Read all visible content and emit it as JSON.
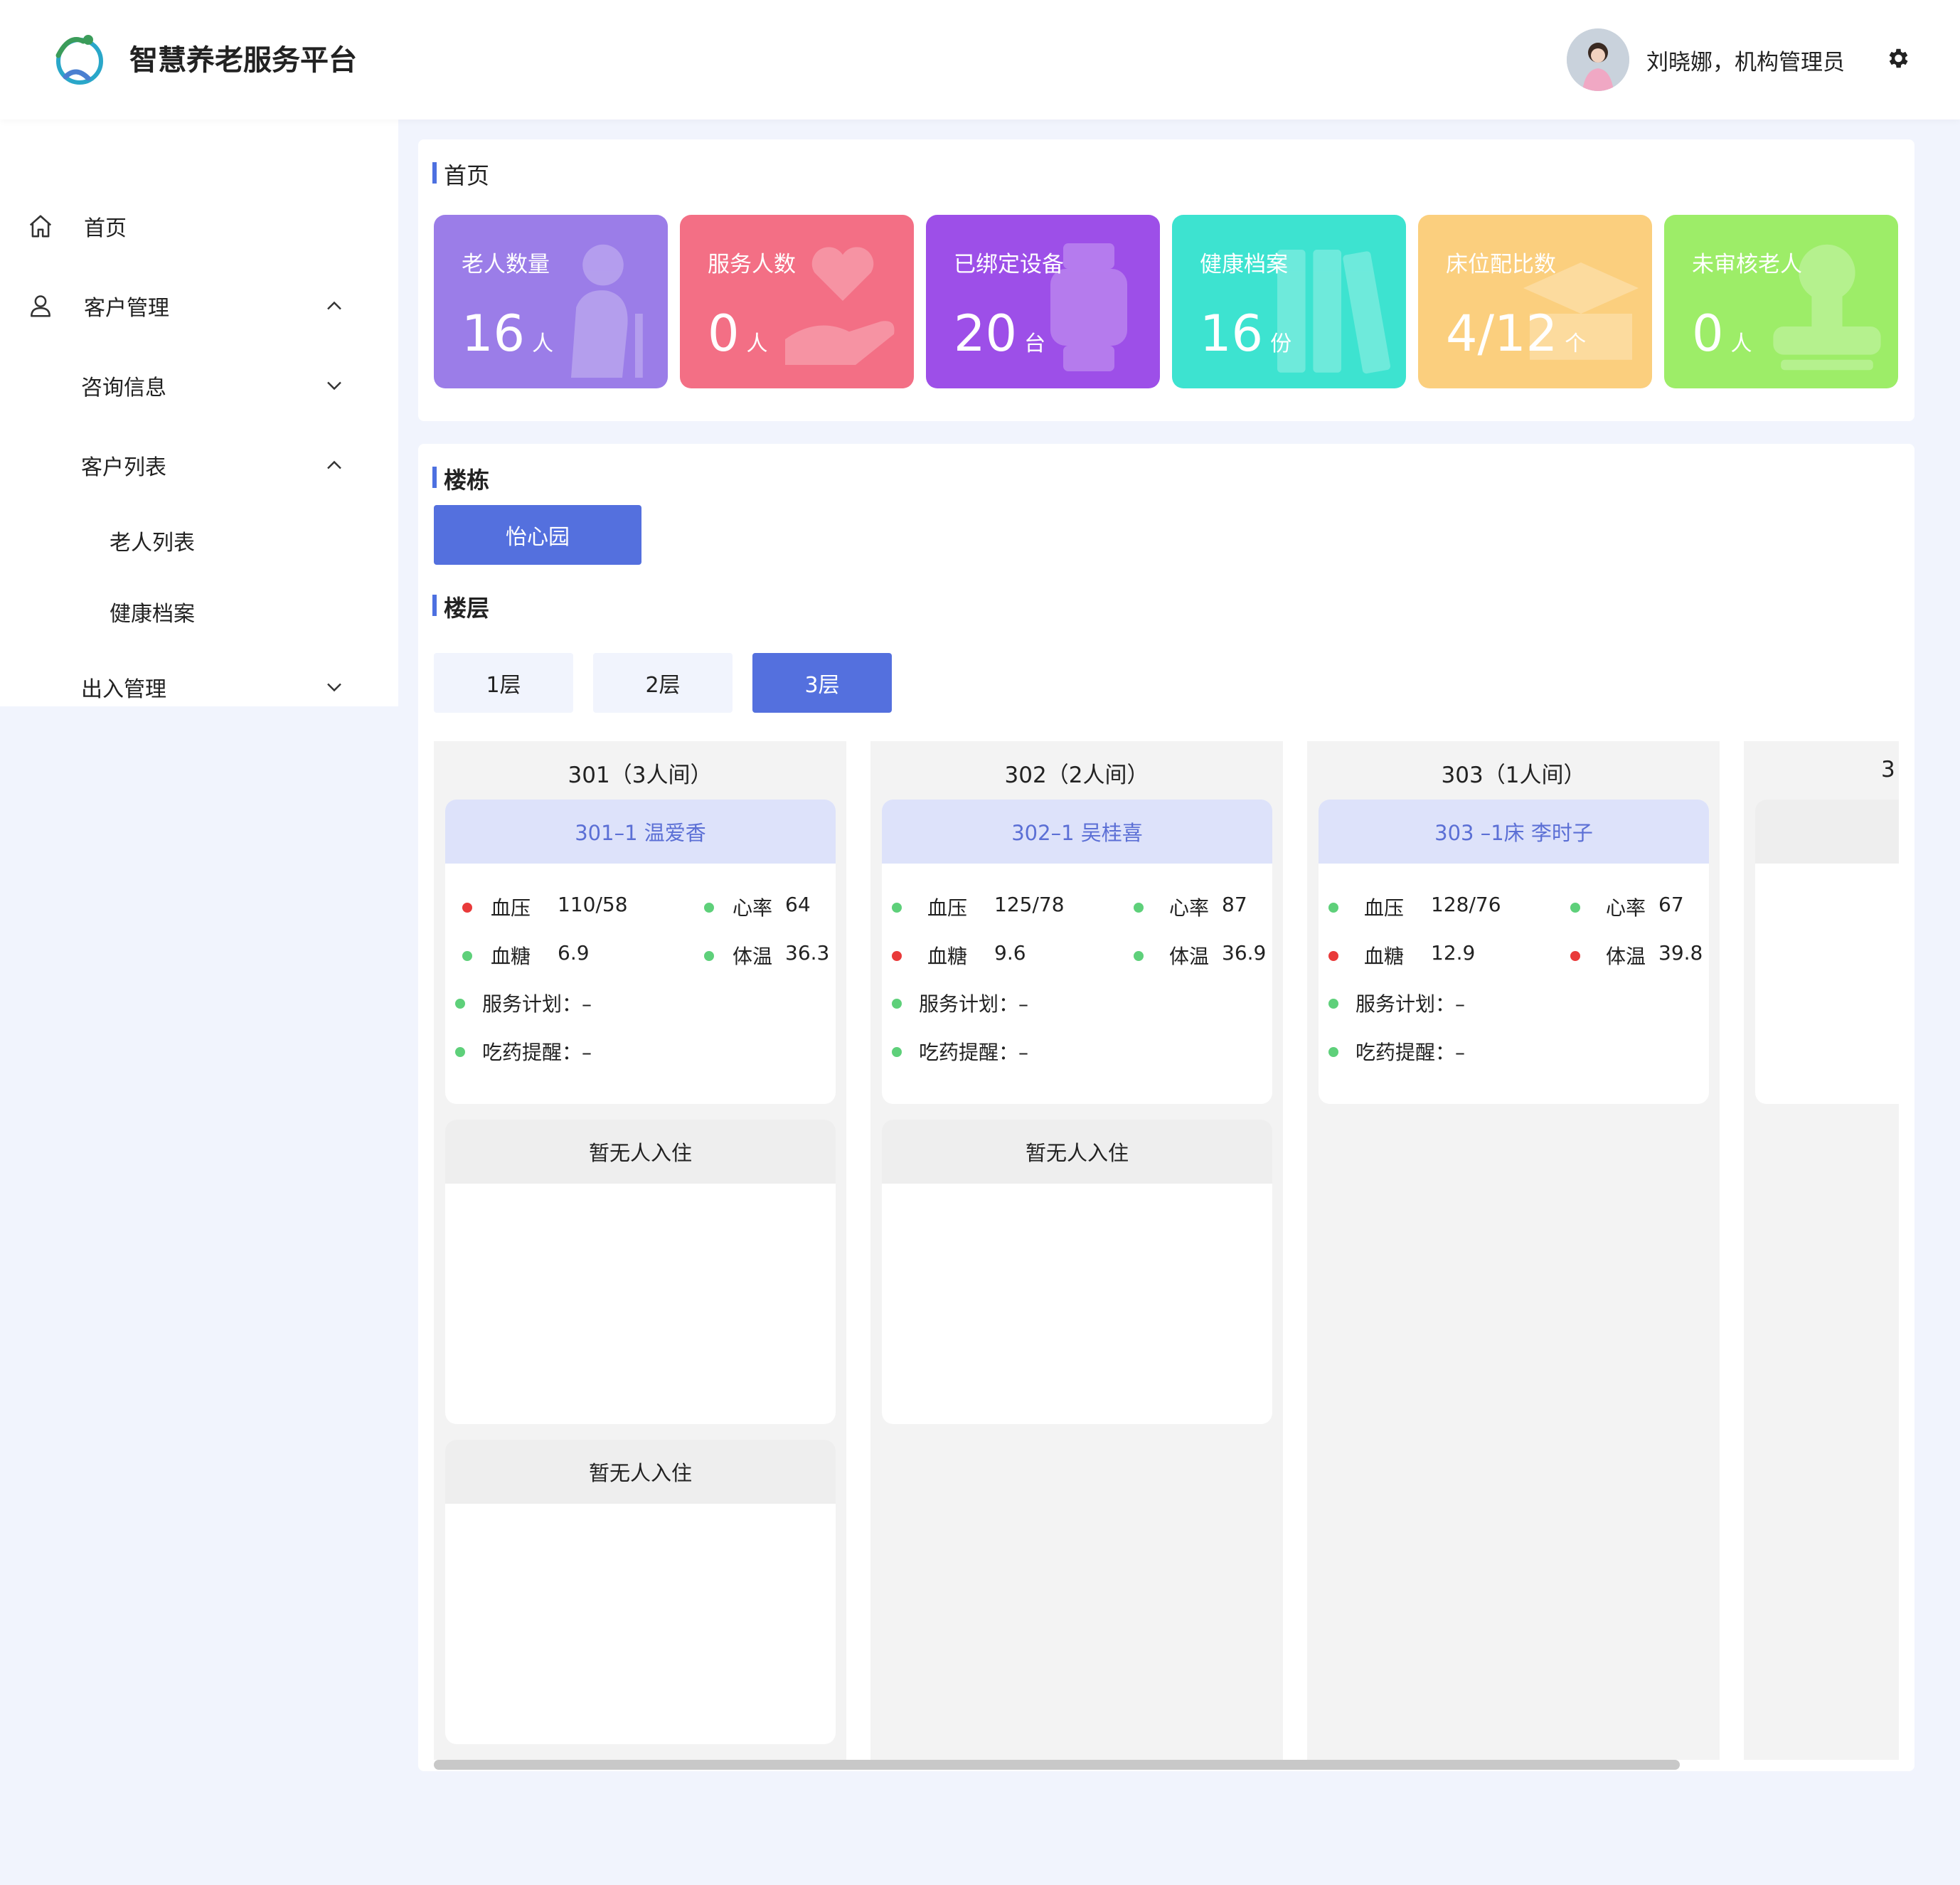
{
  "header": {
    "app_title": "智慧养老服务平台",
    "user_text": "刘晓娜，机构管理员"
  },
  "sidebar": {
    "items": [
      {
        "label": "首页",
        "icon": "home-icon"
      },
      {
        "label": "客户管理",
        "icon": "user-icon",
        "expanded": true
      },
      {
        "label": "咨询信息",
        "expanded": false
      },
      {
        "label": "客户列表",
        "expanded": true
      },
      {
        "label": "老人列表"
      },
      {
        "label": "健康档案"
      },
      {
        "label": "出入管理",
        "expanded": false
      }
    ]
  },
  "home": {
    "title": "首页",
    "stats": [
      {
        "label": "老人数量",
        "value": "16",
        "unit": "人",
        "color": "#9b7de8",
        "icon": "elderly-icon"
      },
      {
        "label": "服务人数",
        "value": "0",
        "unit": "人",
        "color": "#f36f85",
        "icon": "heart-hand-icon"
      },
      {
        "label": "已绑定设备",
        "value": "20",
        "unit": "台",
        "color": "#9d4fe8",
        "icon": "watch-icon"
      },
      {
        "label": "健康档案",
        "value": "16",
        "unit": "份",
        "color": "#3de3d0",
        "icon": "binder-icon"
      },
      {
        "label": "床位配比数",
        "value": "4/12",
        "unit": "个",
        "color": "#fbcf7e",
        "icon": "bed-icon"
      },
      {
        "label": "未审核老人",
        "value": "0",
        "unit": "人",
        "color": "#9ded68",
        "icon": "stamp-icon"
      }
    ]
  },
  "building": {
    "title": "楼栋",
    "selected": "怡心园"
  },
  "floor": {
    "title": "楼层",
    "options": [
      "1层",
      "2层",
      "3层"
    ],
    "selected": "3层"
  },
  "rooms": [
    {
      "title": "301（3人间）",
      "beds": [
        {
          "header": "301–1 温爱香",
          "occupied": true,
          "bp_label": "血压",
          "bp": "110/58",
          "bp_status": "red",
          "hr_label": "心率",
          "hr": "64",
          "hr_status": "green",
          "bs_label": "血糖",
          "bs": "6.9",
          "bs_status": "green",
          "temp_label": "体温",
          "temp": "36.3",
          "temp_status": "green",
          "plan": "服务计划：–",
          "reminder": "吃药提醒：–"
        },
        {
          "header": "暂无人入住",
          "occupied": false
        },
        {
          "header": "暂无人入住",
          "occupied": false
        }
      ]
    },
    {
      "title": "302（2人间）",
      "beds": [
        {
          "header": "302–1 吴桂喜",
          "occupied": true,
          "bp_label": "血压",
          "bp": "125/78",
          "bp_status": "green",
          "hr_label": "心率",
          "hr": "87",
          "hr_status": "green",
          "bs_label": "血糖",
          "bs": "9.6",
          "bs_status": "red",
          "temp_label": "体温",
          "temp": "36.9",
          "temp_status": "green",
          "plan": "服务计划：–",
          "reminder": "吃药提醒：–"
        },
        {
          "header": "暂无人入住",
          "occupied": false
        }
      ]
    },
    {
      "title": "303（1人间）",
      "beds": [
        {
          "header": "303 –1床 李时子",
          "occupied": true,
          "bp_label": "血压",
          "bp": "128/76",
          "bp_status": "green",
          "hr_label": "心率",
          "hr": "67",
          "hr_status": "green",
          "bs_label": "血糖",
          "bs": "12.9",
          "bs_status": "red",
          "temp_label": "体温",
          "temp": "39.8",
          "temp_status": "red",
          "plan": "服务计划：–",
          "reminder": "吃药提醒：–"
        }
      ]
    },
    {
      "title": "3"
    }
  ]
}
